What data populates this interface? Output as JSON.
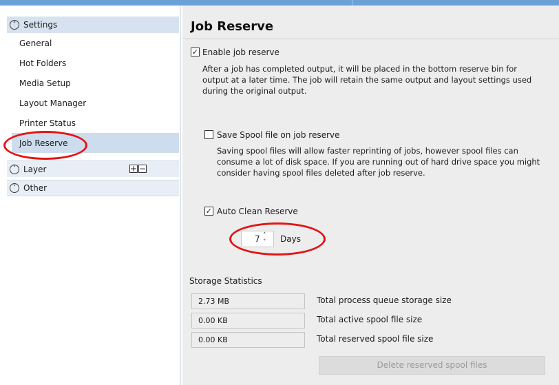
{
  "sidebar": {
    "settings": {
      "label": "Settings",
      "icon": "chevron-up-icon"
    },
    "items": [
      {
        "label": "General"
      },
      {
        "label": "Hot Folders"
      },
      {
        "label": "Media Setup"
      },
      {
        "label": "Layout Manager"
      },
      {
        "label": "Printer Status"
      },
      {
        "label": "Job Reserve",
        "selected": true
      }
    ],
    "layer": {
      "label": "Layer",
      "icon": "chevron-down-icon",
      "plus": "+",
      "minus": "−"
    },
    "other": {
      "label": "Other",
      "icon": "chevron-down-icon"
    }
  },
  "main": {
    "title": "Job Reserve",
    "enable_job_reserve": {
      "label": "Enable job reserve",
      "checked": true,
      "description": "After a job has completed output, it will be placed in the bottom reserve bin for\noutput at a later time. The job will retain the same output and layout settings used\nduring the original output."
    },
    "save_spool": {
      "label": "Save Spool file on job reserve",
      "checked": false,
      "description": "Saving spool files will allow faster reprinting of jobs, however spool files can\nconsume a lot of disk space. If you are running out of hard drive space you might\nconsider having spool files deleted after job reserve."
    },
    "auto_clean": {
      "label": "Auto Clean Reserve",
      "checked": true,
      "days_value": "7",
      "days_label": "Days"
    },
    "storage": {
      "heading": "Storage Statistics",
      "rows": [
        {
          "value": "2.73 MB",
          "label": "Total process queue storage size"
        },
        {
          "value": "0.00 KB",
          "label": "Total active spool file size"
        },
        {
          "value": "0.00 KB",
          "label": "Total reserved spool file size"
        }
      ],
      "delete_button": "Delete reserved spool files"
    }
  },
  "colors": {
    "highlight_ring": "#e31414",
    "selected_bg": "#cdddee",
    "titlebar": "#6aa2d8"
  }
}
